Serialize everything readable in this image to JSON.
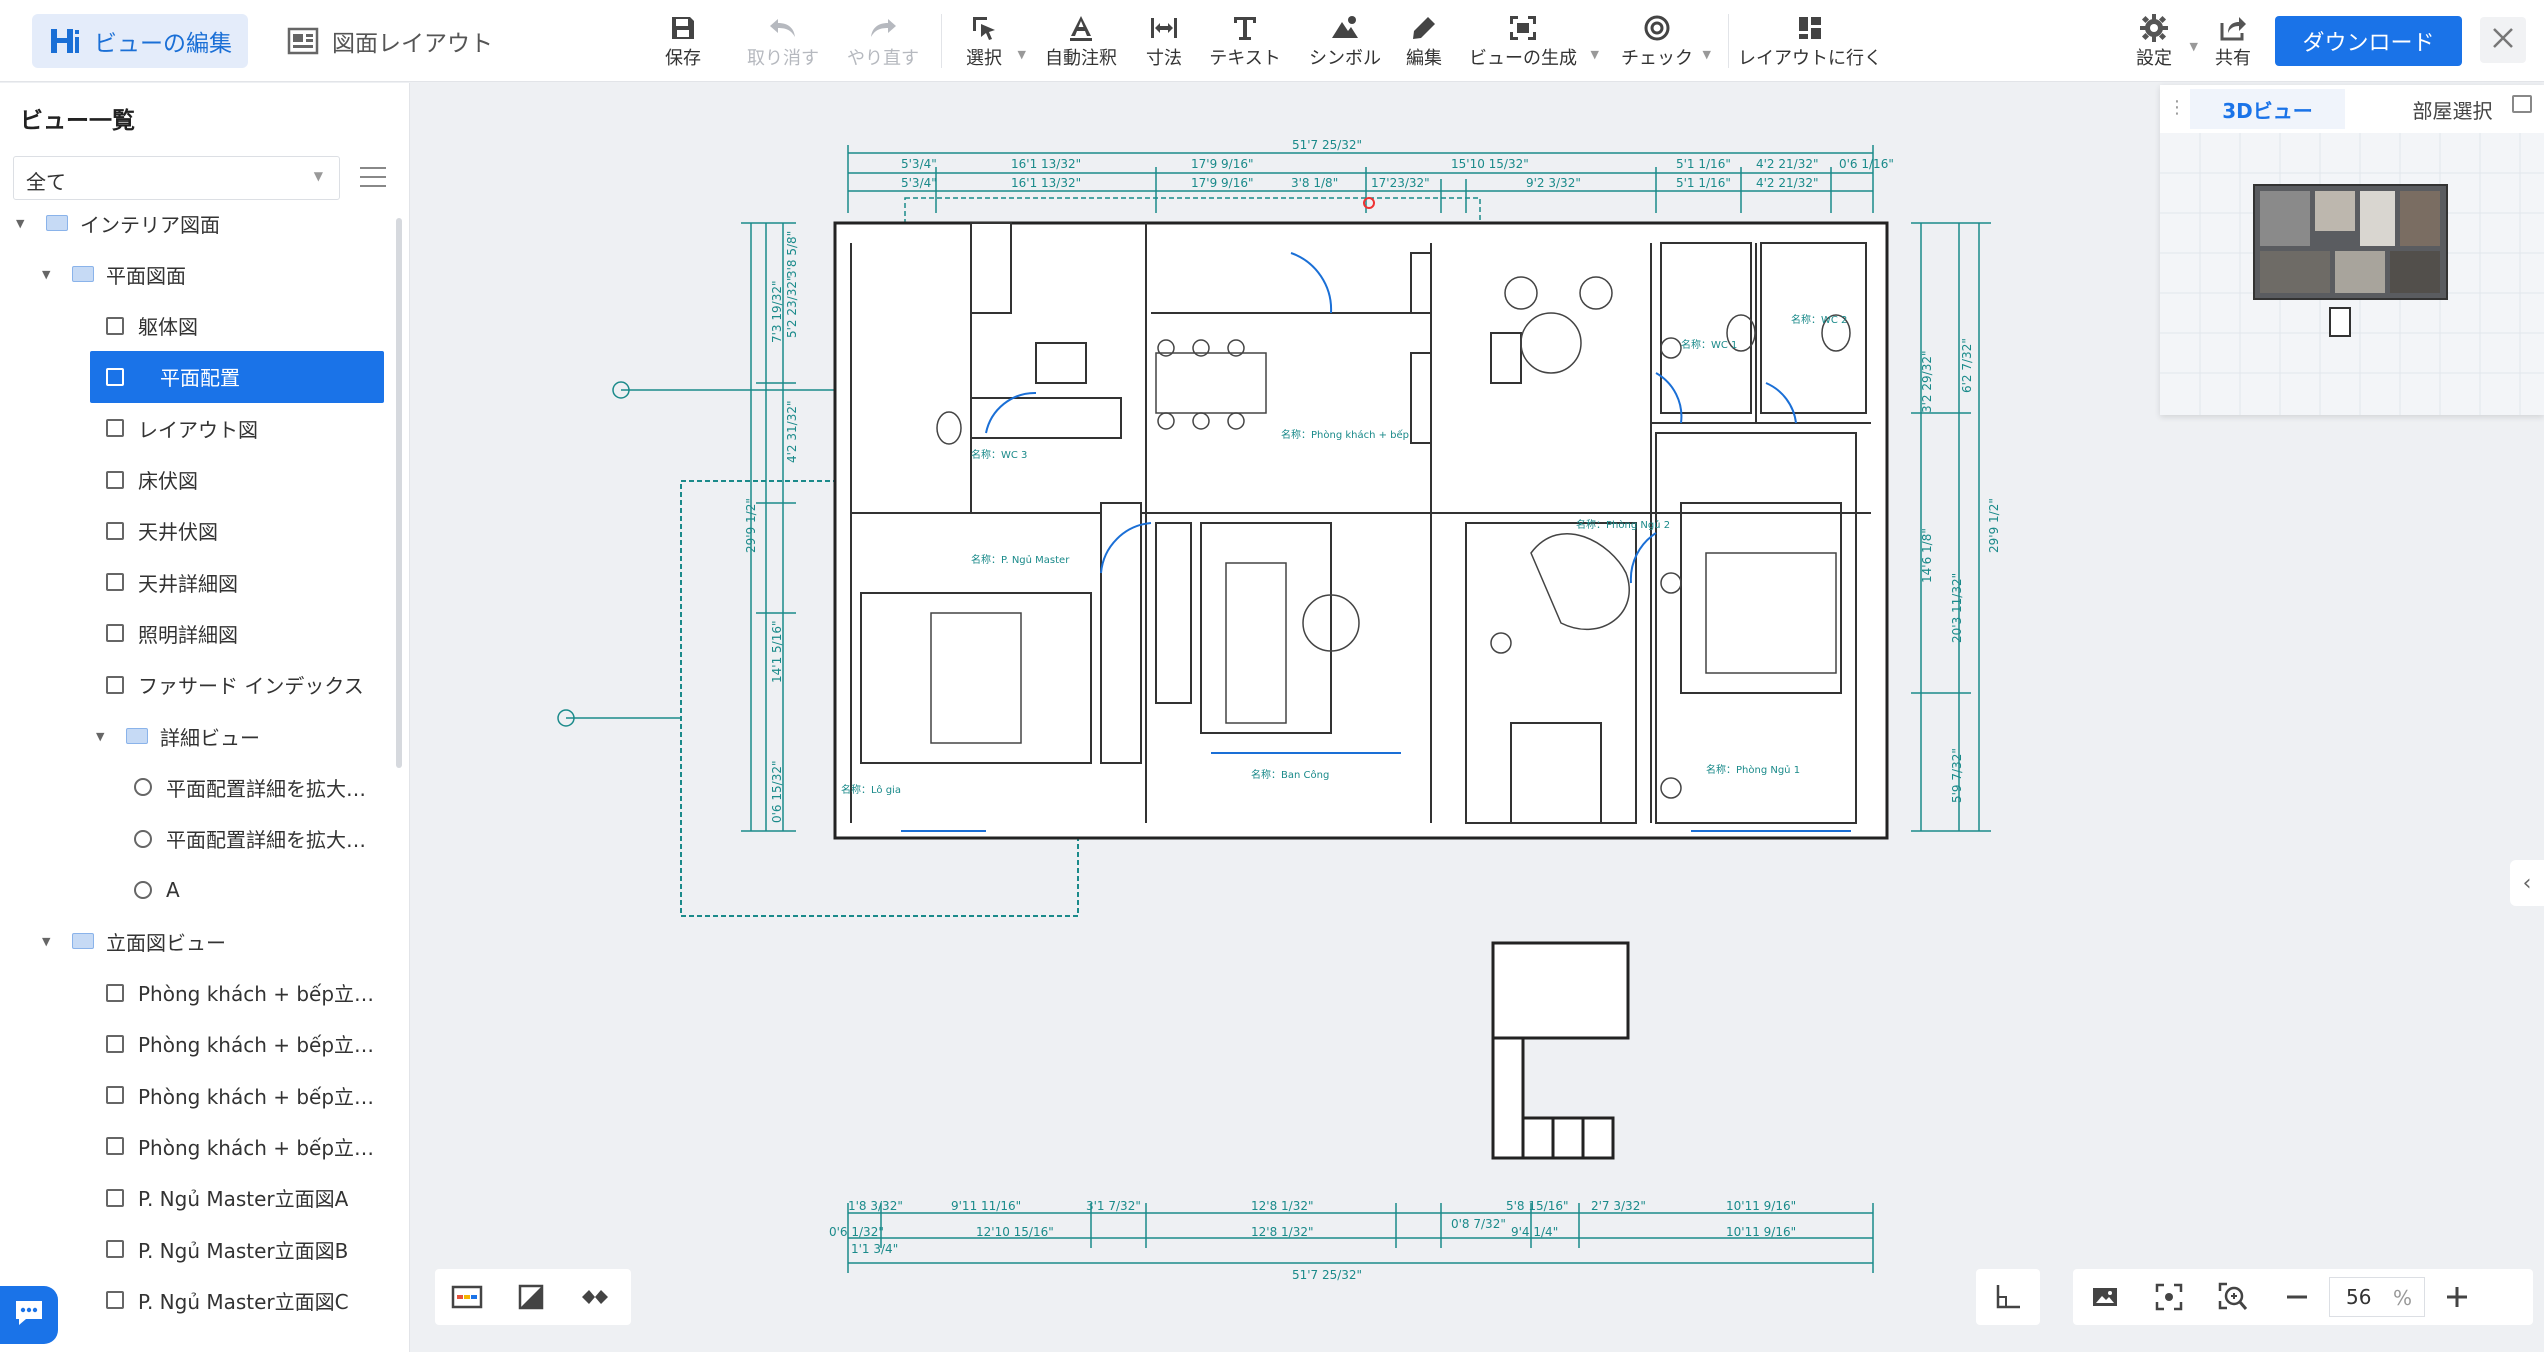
{
  "header": {
    "mode_tabs": [
      {
        "label": "ビューの編集",
        "active": true
      },
      {
        "label": "図面レイアウト",
        "active": false
      }
    ],
    "tools": [
      {
        "label": "保存",
        "icon": "save-icon",
        "disabled": false
      },
      {
        "label": "取り消す",
        "icon": "undo-icon",
        "disabled": true
      },
      {
        "label": "やり直す",
        "icon": "redo-icon",
        "disabled": true
      },
      {
        "label": "選択",
        "icon": "select-icon",
        "disabled": false
      },
      {
        "label": "自動注釈",
        "icon": "auto-annotate-icon",
        "disabled": false
      },
      {
        "label": "寸法",
        "icon": "dimension-icon",
        "disabled": false
      },
      {
        "label": "テキスト",
        "icon": "text-icon",
        "disabled": false
      },
      {
        "label": "シンボル",
        "icon": "symbol-icon",
        "disabled": false
      },
      {
        "label": "編集",
        "icon": "edit-pen-icon",
        "disabled": false
      },
      {
        "label": "ビューの生成",
        "icon": "generate-view-icon",
        "disabled": false
      },
      {
        "label": "チェック",
        "icon": "check-icon",
        "disabled": false
      },
      {
        "label": "レイアウトに行く",
        "icon": "go-layout-icon",
        "disabled": false
      }
    ],
    "settings_label": "設定",
    "share_label": "共有",
    "download_label": "ダウンロード",
    "accent_color": "#1a73e8"
  },
  "sidebar": {
    "title": "ビュー一覧",
    "filter_value": "全て",
    "tree": [
      {
        "label": "インテリア図面",
        "level": 0,
        "type": "folder",
        "expanded": true
      },
      {
        "label": "平面図面",
        "level": 1,
        "type": "folder",
        "expanded": true
      },
      {
        "label": "躯体図",
        "level": 2,
        "type": "plan"
      },
      {
        "label": "平面配置",
        "level": 2,
        "type": "plan",
        "selected": true
      },
      {
        "label": "レイアウト図",
        "level": 2,
        "type": "plan"
      },
      {
        "label": "床伏図",
        "level": 2,
        "type": "plan"
      },
      {
        "label": "天井伏図",
        "level": 2,
        "type": "ceiling"
      },
      {
        "label": "天井詳細図",
        "level": 2,
        "type": "ceiling"
      },
      {
        "label": "照明詳細図",
        "level": 2,
        "type": "ceiling"
      },
      {
        "label": "ファサード インデックス",
        "level": 2,
        "type": "facade"
      },
      {
        "label": "詳細ビュー",
        "level": 2,
        "type": "folder",
        "expanded": true
      },
      {
        "label": "平面配置詳細を拡大…",
        "level": 3,
        "type": "detail"
      },
      {
        "label": "平面配置詳細を拡大…",
        "level": 3,
        "type": "detail"
      },
      {
        "label": "A",
        "level": 3,
        "type": "detail"
      },
      {
        "label": "立面図ビュー",
        "level": 1,
        "type": "folder",
        "expanded": true
      },
      {
        "label": "Phòng khách + bếp立…",
        "level": 2,
        "type": "elevation"
      },
      {
        "label": "Phòng khách + bếp立…",
        "level": 2,
        "type": "elevation"
      },
      {
        "label": "Phòng khách + bếp立…",
        "level": 2,
        "type": "elevation"
      },
      {
        "label": "Phòng khách + bếp立…",
        "level": 2,
        "type": "elevation"
      },
      {
        "label": "P. Ngủ Master立面図A",
        "level": 2,
        "type": "elevation"
      },
      {
        "label": "P. Ngủ Master立面図B",
        "level": 2,
        "type": "elevation"
      },
      {
        "label": "P. Ngủ Master立面図C",
        "level": 2,
        "type": "elevation"
      }
    ]
  },
  "panel3d": {
    "tabs": [
      {
        "label": "3Dビュー",
        "active": true
      },
      {
        "label": "部屋選択",
        "active": false
      }
    ]
  },
  "zoom": {
    "value": "56",
    "unit": "%"
  },
  "drawing": {
    "top_total": "51'7 25/32\"",
    "top_row1": [
      "5'3/4\"",
      "16'1 13/32\"",
      "17'9 9/16\"",
      "15'10 15/32\"",
      "5'1 1/16\"",
      "4'2 21/32\"",
      "0'6 1/16\""
    ],
    "top_row2": [
      "5'3/4\"",
      "16'1 13/32\"",
      "17'9 9/16\"",
      "3'8 1/8\"",
      "17'23/32\"",
      "9'2 3/32\"",
      "5'1 1/16\"",
      "4'2 21/32\""
    ],
    "bottom_row1": [
      "1'8 3/32\"",
      "9'11 11/16\"",
      "3'1 7/32\"",
      "12'8 1/32\"",
      "5'8 15/16\"",
      "2'7 3/32\"",
      "10'11 9/16\""
    ],
    "bottom_row2": [
      "0'6 1/32\"",
      "12'10 15/16\"",
      "12'8 1/32\"",
      "9'4 1/4\"",
      "10'11 9/16\""
    ],
    "bottom_extra": [
      "1'1 3/4\"",
      "0'8 7/32\""
    ],
    "bottom_total": "51'7 25/32\"",
    "left_dims": [
      "29'9 1/2\"",
      "14'1 5/16\"",
      "4'2 31/32\"",
      "7'3 19/32\"",
      "5'2 23/32\"",
      "0'6 15/32\"",
      "3'8 5/8\""
    ],
    "right_dims": [
      "29'9 1/2\"",
      "14'6 1/8\"",
      "20'3 11/32\"",
      "5'9 7/32\"",
      "6'2 7/32\"",
      "3'2 29/32\""
    ],
    "room_labels": [
      {
        "text": "名称：Phòng khách + bếp"
      },
      {
        "text": "名称：P. Ngủ Master"
      },
      {
        "text": "名称：Phòng Ngủ 1"
      },
      {
        "text": "名称：Phòng Ngủ 2"
      },
      {
        "text": "名称：WC 1"
      },
      {
        "text": "名称：WC 2"
      },
      {
        "text": "名称：WC 3"
      },
      {
        "text": "名称：Ban Công"
      },
      {
        "text": "名称：Lô gia"
      }
    ]
  }
}
